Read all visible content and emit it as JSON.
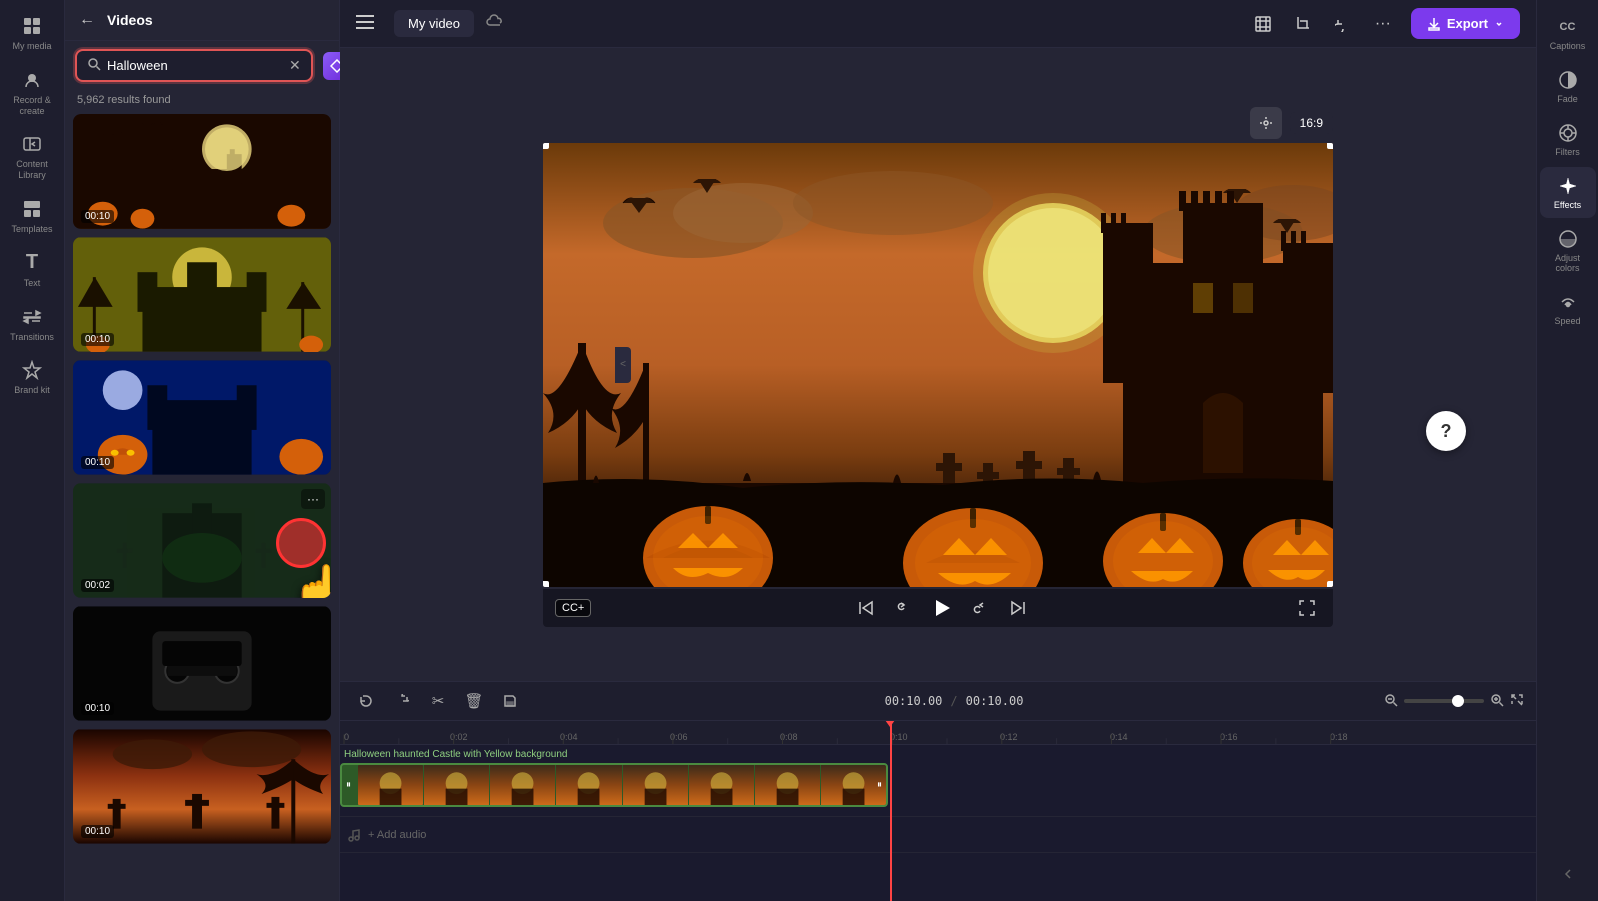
{
  "app": {
    "title": "Videos"
  },
  "topbar": {
    "tab_my_video": "My video",
    "export_label": "Export"
  },
  "search": {
    "query": "Halloween",
    "placeholder": "Search",
    "results_count": "5,962 results found"
  },
  "sidebar_left": {
    "items": [
      {
        "id": "my-media",
        "label": "My media",
        "icon": "⊞"
      },
      {
        "id": "record",
        "label": "Record &\ncreate",
        "icon": "⏺"
      },
      {
        "id": "content-library",
        "label": "Content Library",
        "icon": "🖼"
      },
      {
        "id": "templates",
        "label": "Templates",
        "icon": "▦"
      },
      {
        "id": "text",
        "label": "Text",
        "icon": "T"
      },
      {
        "id": "transitions",
        "label": "Transitions",
        "icon": "⇄"
      },
      {
        "id": "brand-kit",
        "label": "Brand kit",
        "icon": "◈"
      }
    ]
  },
  "right_panel": {
    "items": [
      {
        "id": "captions",
        "label": "Captions",
        "icon": "CC"
      },
      {
        "id": "fade",
        "label": "Fade",
        "icon": "◑"
      },
      {
        "id": "filters",
        "label": "Filters",
        "icon": "⊕"
      },
      {
        "id": "effects",
        "label": "Effects",
        "icon": "✦",
        "active": true
      },
      {
        "id": "adjust-colors",
        "label": "Adjust colors",
        "icon": "◐"
      },
      {
        "id": "speed",
        "label": "Speed",
        "icon": "⏩"
      }
    ]
  },
  "videos": [
    {
      "id": 1,
      "duration": "00:10",
      "bg_color": "#1a0a00",
      "gradient": "linear-gradient(180deg,#2d1505 0%,#c46a1a 40%,#8b4010 70%,#1a0a00 100%)"
    },
    {
      "id": 2,
      "duration": "00:10",
      "bg_color": "#2d3a00",
      "gradient": "linear-gradient(180deg,#1a2a00 0%,#4a6a10 30%,#c8a020 60%,#2d3a00 100%)"
    },
    {
      "id": 3,
      "duration": "00:10",
      "bg_color": "#001030",
      "gradient": "linear-gradient(180deg,#001030 0%,#002060 30%,#0040a0 50%,#001030 100%)"
    },
    {
      "id": 4,
      "duration": "00:02",
      "bg_color": "#0a1a0a",
      "gradient": "linear-gradient(180deg,#0a1a0a 0%,#1a3a1a 40%,#0a1a0a 100%)",
      "has_more": true,
      "is_dragging": true
    },
    {
      "id": 5,
      "duration": "00:10",
      "bg_color": "#050505",
      "gradient": "linear-gradient(180deg,#050505 0%,#1a1a1a 40%,#050505 100%)"
    },
    {
      "id": 6,
      "duration": "00:10",
      "bg_color": "#2a1500",
      "gradient": "linear-gradient(180deg,#2a1500 0%,#8b4010 40%,#c86010 60%,#2a1500 100%)"
    }
  ],
  "timeline": {
    "current_time": "00:10.00",
    "total_time": "00:10.00",
    "clip_label": "Halloween haunted Castle with Yellow background",
    "rulers": [
      "0",
      "0:02",
      "0:04",
      "0:06",
      "0:08",
      "0:10",
      "0:12",
      "0:14",
      "0:16",
      "0:18"
    ],
    "audio_label": "+ Add audio"
  },
  "canvas": {
    "aspect_ratio": "16:9"
  }
}
